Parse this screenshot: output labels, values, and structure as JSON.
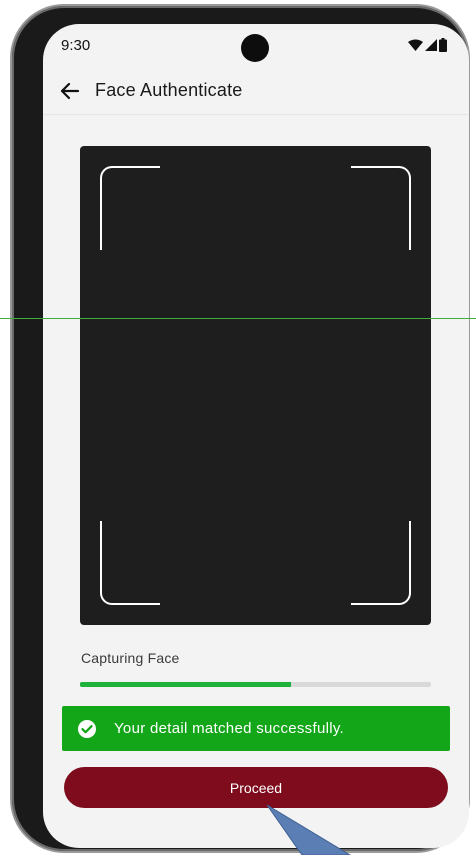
{
  "status_bar": {
    "time": "9:30",
    "icons": [
      "wifi-icon",
      "signal-icon",
      "battery-icon"
    ]
  },
  "app_bar": {
    "back_icon": "arrow-left-icon",
    "title": "Face Authenticate"
  },
  "camera": {
    "frame_corners": [
      "top-left",
      "top-right",
      "bottom-left",
      "bottom-right"
    ]
  },
  "progress": {
    "label": "Capturing Face",
    "value": 0.6
  },
  "success_banner": {
    "icon": "check-circle-icon",
    "message": "Your detail matched successfully."
  },
  "actions": {
    "proceed_label": "Proceed"
  },
  "colors": {
    "success_green": "#14a619",
    "progress_green": "#1fb23a",
    "primary_maroon": "#7e0c1d",
    "camera_bg": "#1e1e1e",
    "screen_bg": "#f3f3f3"
  }
}
